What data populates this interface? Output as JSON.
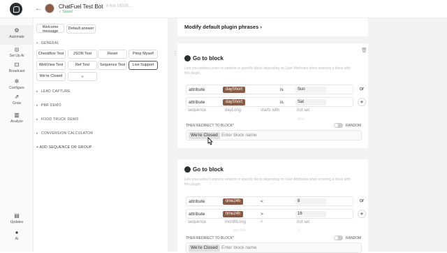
{
  "header": {
    "bot_name": "ChatFuel Test Bot",
    "chevron": "˅",
    "bot_id": "# bot 18028...",
    "status": "✓ Saved"
  },
  "rail": [
    {
      "label": "Automate",
      "icon": "gear-icon",
      "glyph": "⚙"
    },
    {
      "label": "Set Up AI",
      "icon": "ai-icon",
      "glyph": "◎"
    },
    {
      "label": "Broadcast",
      "icon": "broadcast-icon",
      "glyph": "⊡"
    },
    {
      "label": "Configure",
      "icon": "configure-icon",
      "glyph": "✲"
    },
    {
      "label": "Grow",
      "icon": "grow-icon",
      "glyph": "⇗"
    },
    {
      "label": "Analyze",
      "icon": "analyze-icon",
      "glyph": "▥"
    },
    {
      "label": "Updates",
      "icon": "updates-icon",
      "glyph": "▤"
    },
    {
      "label": "AI",
      "icon": "ai-avatar-icon",
      "glyph": "●"
    }
  ],
  "blocks": {
    "welcome": "Welcome message",
    "welcome_1": "Welcome",
    "welcome_2": "message",
    "default_answer": "Default answer",
    "general_label": "GENERAL",
    "general": [
      "CheckBox Test",
      "JSON Test",
      "Reset",
      "Pimp Myself",
      "WebView Test",
      "Ref Test",
      "Sequence Test",
      "Live Support",
      "We're Closed"
    ],
    "add_plus": "+",
    "groups": [
      "LEAD CAPTURE",
      "PBR DEMO",
      "FOOD TRUCK DEMO",
      "CONVERSION CALCULATOR"
    ],
    "add_group": "+ ADD SEQUENCE OR GROUP"
  },
  "main": {
    "modify_title": "Modify default plugin phrases  ›",
    "card1": {
      "title": "Go to block",
      "desc": "Lets you redirect users to random or specific block depending on User Attributes when entering a block with this plugin.",
      "rows": [
        {
          "type": "attribute",
          "name": "dayShort",
          "op": "is",
          "value": "Sun",
          "right": "or"
        },
        {
          "type": "attribute",
          "name": "dayShort",
          "op": "is",
          "value": "Sat",
          "right": "+"
        }
      ],
      "ghost": {
        "type": "sequence",
        "name": "dayLong",
        "op": "starts with",
        "value": "not set"
      },
      "faint_value": "Mon",
      "redirect_label": "THEN REDIRECT TO BLOCK*",
      "random_label": "RANDOM",
      "chip": "We're Closed",
      "placeholder": "Enter block name"
    },
    "card2": {
      "title": "Go to block",
      "desc": "Lets you redirect users to random or specific block depending on User Attributes when entering a block with this plugin.",
      "rows": [
        {
          "type": "attribute",
          "name": "time24h",
          "op": "<",
          "value": "8",
          "right": "or"
        },
        {
          "type": "attribute",
          "name": "time24h",
          "op": ">",
          "value": "16",
          "right": "+"
        }
      ],
      "ghost": {
        "type": "sequence",
        "name": "monthLong",
        "op": "<",
        "value": "not set"
      },
      "faint_name": "time24h",
      "faint_value": "8",
      "redirect_label": "THEN REDIRECT TO BLOCK*",
      "random_label": "RANDOM",
      "chip": "We're Closed",
      "placeholder": "Enter block name"
    }
  }
}
